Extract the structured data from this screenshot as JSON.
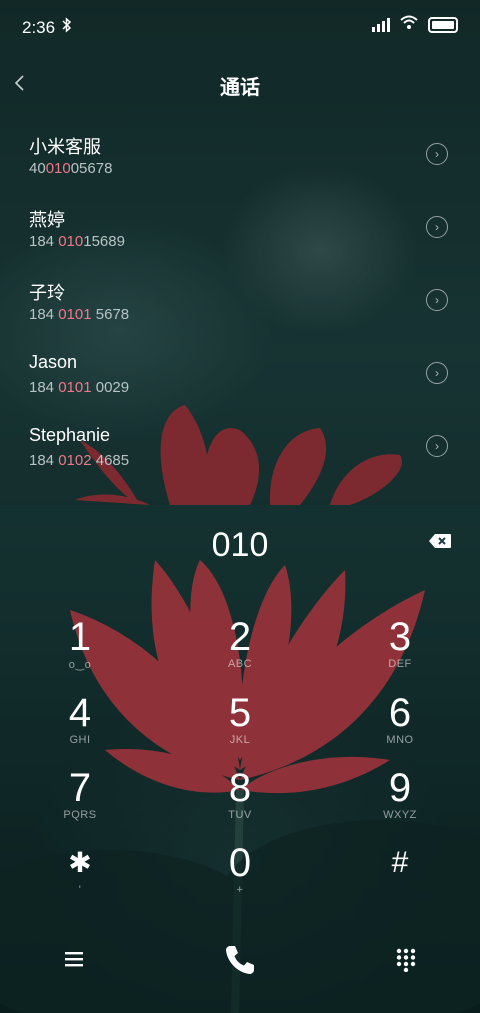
{
  "status_bar": {
    "time": "2:36",
    "bluetooth_icon": "bluetooth-icon",
    "signal_icon": "signal-icon",
    "wifi_icon": "wifi-icon",
    "battery_icon": "battery-icon"
  },
  "header": {
    "title": "通话",
    "back_icon": "chevron-left-icon"
  },
  "contacts": [
    {
      "name": "小米客服",
      "num_pre": "40",
      "num_hl": "010",
      "num_post": "05678"
    },
    {
      "name": "燕婷",
      "num_pre": "184 ",
      "num_hl": "010",
      "num_post": "15689"
    },
    {
      "name": "子玲",
      "num_pre": "184 ",
      "num_hl": "0101",
      "num_post": " 5678"
    },
    {
      "name": "Jason",
      "num_pre": "184 ",
      "num_hl": "0101",
      "num_post": " 0029"
    },
    {
      "name": "Stephanie",
      "num_pre": "184 ",
      "num_hl": "0102",
      "num_post": " 4685"
    }
  ],
  "dial": {
    "display": "010"
  },
  "keypad": [
    {
      "digit": "1",
      "letters": "ᴏᴏ"
    },
    {
      "digit": "2",
      "letters": "ABC"
    },
    {
      "digit": "3",
      "letters": "DEF"
    },
    {
      "digit": "4",
      "letters": "GHI"
    },
    {
      "digit": "5",
      "letters": "JKL"
    },
    {
      "digit": "6",
      "letters": "MNO"
    },
    {
      "digit": "7",
      "letters": "PQRS"
    },
    {
      "digit": "8",
      "letters": "TUV"
    },
    {
      "digit": "9",
      "letters": "WXYZ"
    },
    {
      "digit": "✱",
      "letters": "'"
    },
    {
      "digit": "0",
      "letters": "+"
    },
    {
      "digit": "#",
      "letters": ""
    }
  ],
  "bottom_bar": {
    "menu_icon": "menu-icon",
    "call_icon": "phone-icon",
    "keypad_icon": "dialpad-icon"
  },
  "colors": {
    "highlight": "#f0788a",
    "background": "#1c3f3e",
    "lotus": "#c0303a"
  }
}
